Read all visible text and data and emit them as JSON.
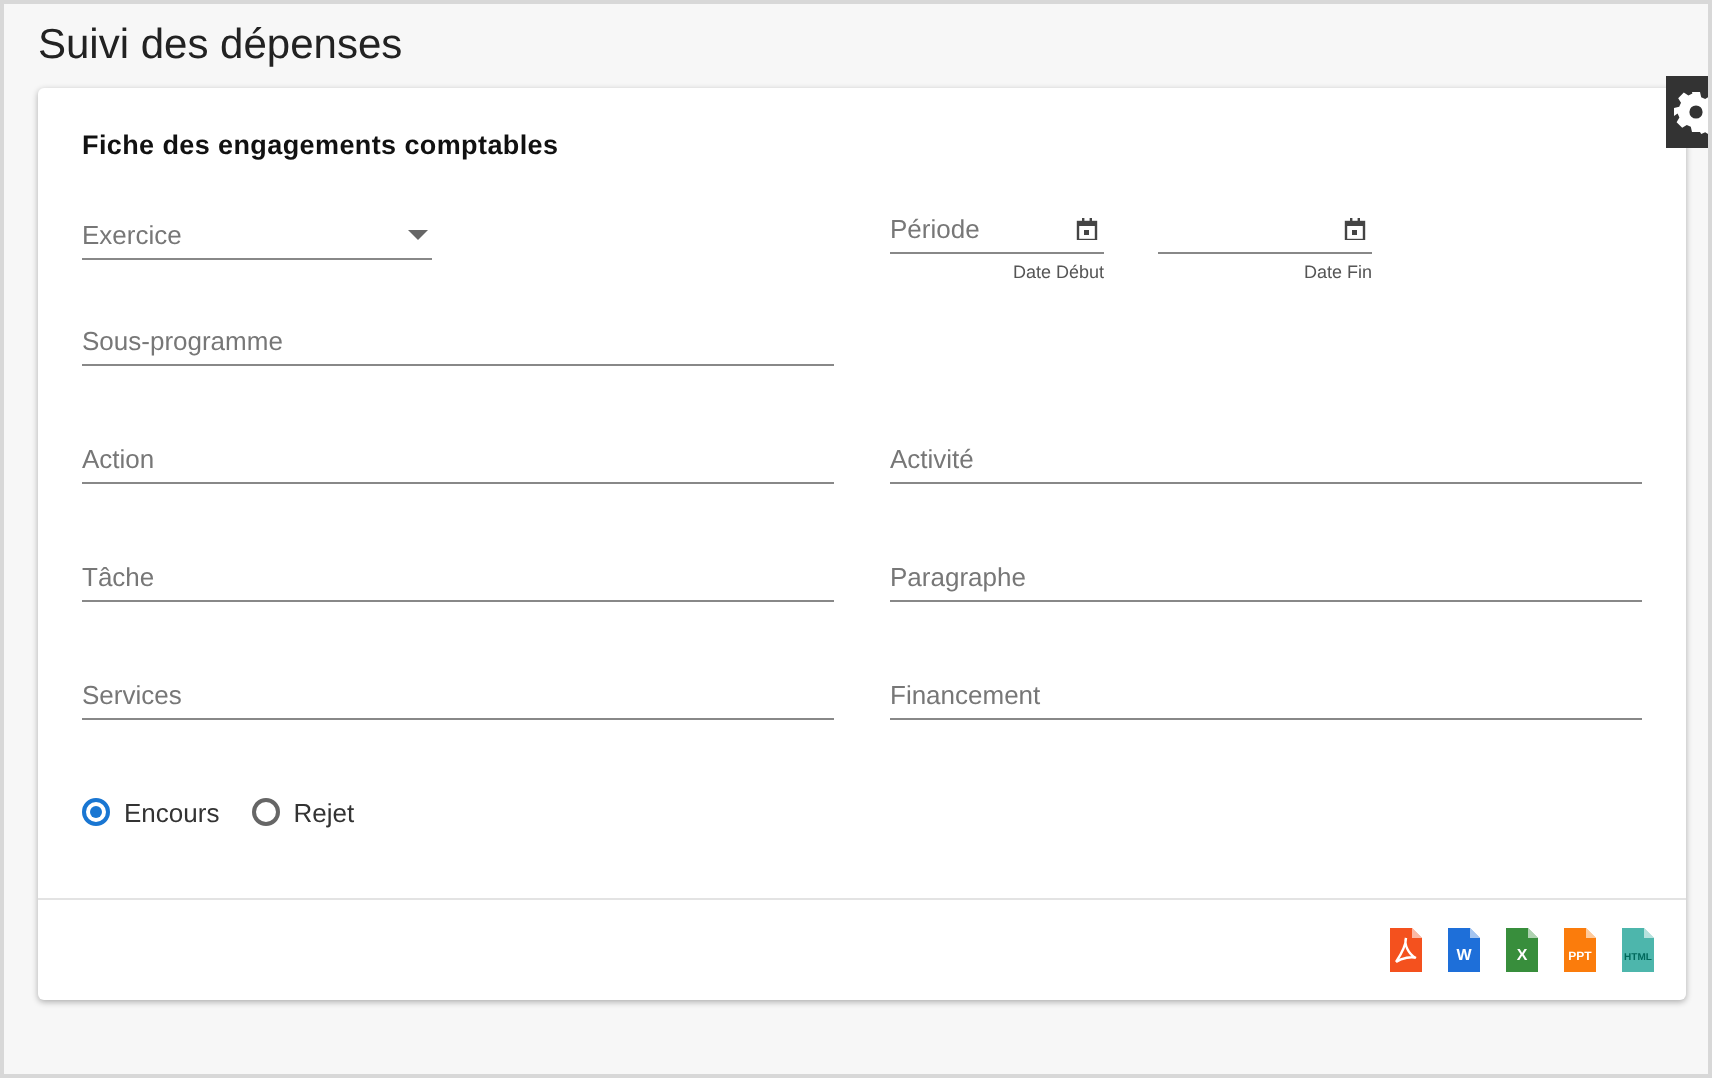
{
  "page_title": "Suivi des dépenses",
  "card": {
    "title": "Fiche des engagements comptables",
    "exercice": {
      "placeholder": "Exercice"
    },
    "period": {
      "placeholder": "Période",
      "start_hint": "Date Début",
      "end_hint": "Date Fin"
    },
    "rows": [
      [
        {
          "placeholder": "Sous-programme"
        }
      ],
      [
        {
          "placeholder": "Action"
        },
        {
          "placeholder": "Activité"
        }
      ],
      [
        {
          "placeholder": "Tâche"
        },
        {
          "placeholder": "Paragraphe"
        }
      ],
      [
        {
          "placeholder": "Services"
        },
        {
          "placeholder": "Financement"
        }
      ]
    ],
    "status_options": [
      {
        "label": "Encours",
        "selected": true
      },
      {
        "label": "Rejet",
        "selected": false
      }
    ],
    "exports": [
      {
        "kind": "pdf"
      },
      {
        "kind": "word",
        "label": "W"
      },
      {
        "kind": "excel",
        "label": "X"
      },
      {
        "kind": "powerpoint",
        "label": "PPT"
      },
      {
        "kind": "html",
        "label": "HTML"
      }
    ]
  }
}
